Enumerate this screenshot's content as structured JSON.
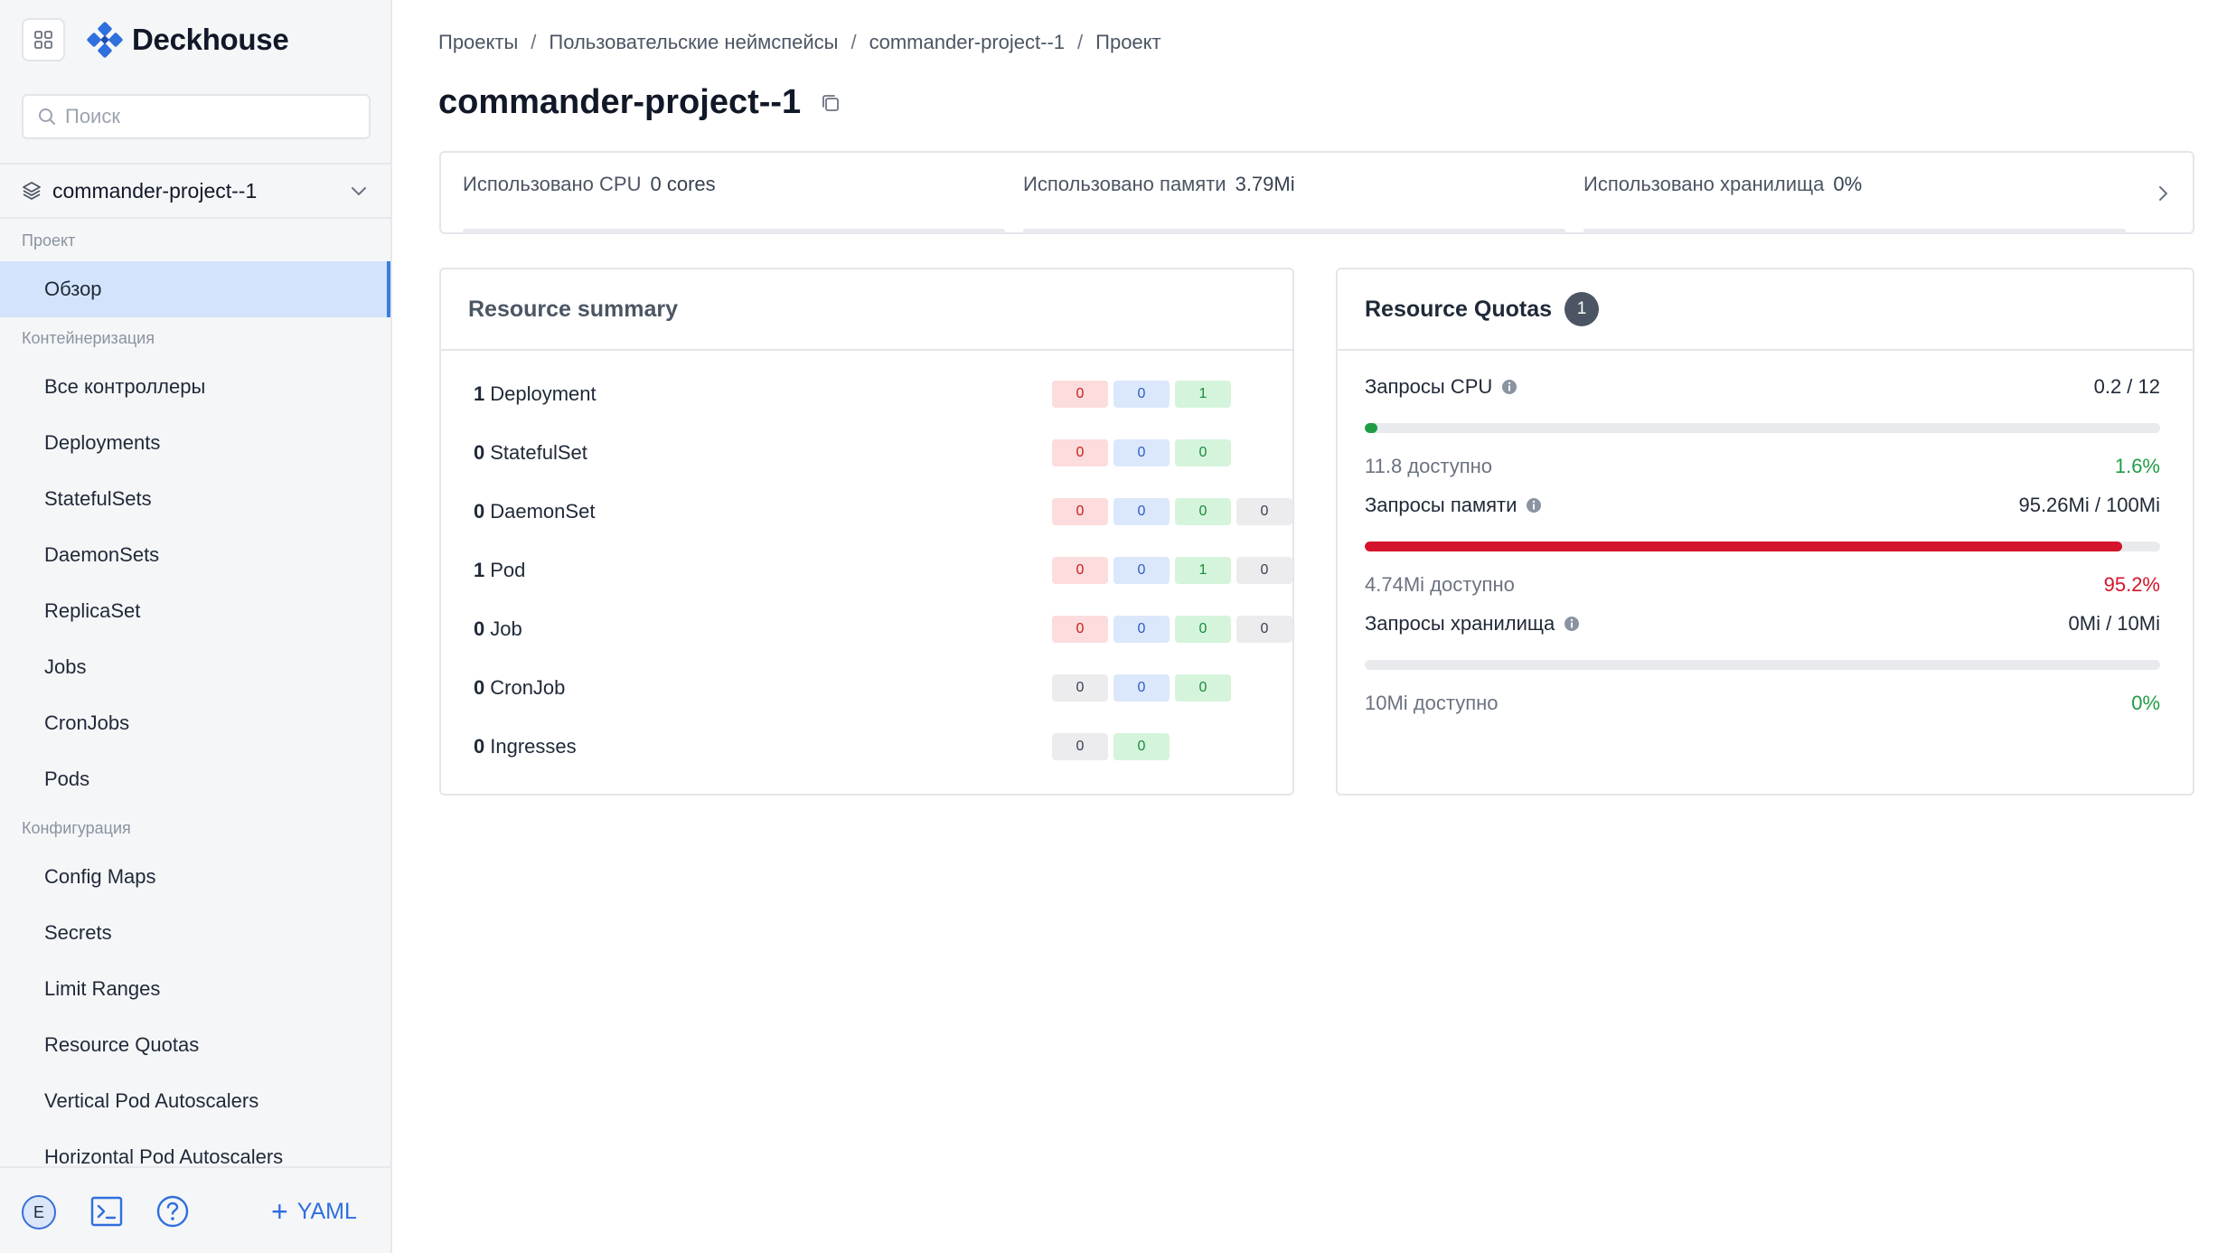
{
  "app": {
    "brand": "Deckhouse"
  },
  "search": {
    "placeholder": "Поиск"
  },
  "namespace": {
    "name": "commander-project--1"
  },
  "nav": {
    "groups": [
      {
        "label": "Проект",
        "items": [
          {
            "label": "Обзор",
            "active": true
          }
        ]
      },
      {
        "label": "Контейнеризация",
        "items": [
          {
            "label": "Все контроллеры"
          },
          {
            "label": "Deployments"
          },
          {
            "label": "StatefulSets"
          },
          {
            "label": "DaemonSets"
          },
          {
            "label": "ReplicaSet"
          },
          {
            "label": "Jobs"
          },
          {
            "label": "CronJobs"
          },
          {
            "label": "Pods"
          }
        ]
      },
      {
        "label": "Конфигурация",
        "items": [
          {
            "label": "Config Maps"
          },
          {
            "label": "Secrets"
          },
          {
            "label": "Limit Ranges"
          },
          {
            "label": "Resource Quotas"
          },
          {
            "label": "Vertical Pod Autoscalers"
          },
          {
            "label": "Horizontal Pod Autoscalers"
          }
        ]
      }
    ]
  },
  "footer": {
    "avatar": "E",
    "yaml_label": "YAML"
  },
  "breadcrumb": [
    "Проекты",
    "Пользовательские неймспейсы",
    "commander-project--1",
    "Проект"
  ],
  "page": {
    "title": "commander-project--1"
  },
  "usage": [
    {
      "label": "Использовано CPU",
      "value": "0 cores"
    },
    {
      "label": "Использовано памяти",
      "value": "3.79Mi"
    },
    {
      "label": "Использовано хранилища",
      "value": "0%"
    }
  ],
  "resource_summary": {
    "title": "Resource summary",
    "rows": [
      {
        "count": "1",
        "kind": "Deployment",
        "pills": [
          {
            "c": "red",
            "v": "0"
          },
          {
            "c": "blue",
            "v": "0"
          },
          {
            "c": "green",
            "v": "1"
          }
        ]
      },
      {
        "count": "0",
        "kind": "StatefulSet",
        "pills": [
          {
            "c": "red",
            "v": "0"
          },
          {
            "c": "blue",
            "v": "0"
          },
          {
            "c": "green",
            "v": "0"
          }
        ]
      },
      {
        "count": "0",
        "kind": "DaemonSet",
        "pills": [
          {
            "c": "red",
            "v": "0"
          },
          {
            "c": "blue",
            "v": "0"
          },
          {
            "c": "green",
            "v": "0"
          },
          {
            "c": "gray",
            "v": "0"
          }
        ]
      },
      {
        "count": "1",
        "kind": "Pod",
        "pills": [
          {
            "c": "red",
            "v": "0"
          },
          {
            "c": "blue",
            "v": "0"
          },
          {
            "c": "green",
            "v": "1"
          },
          {
            "c": "gray",
            "v": "0"
          }
        ]
      },
      {
        "count": "0",
        "kind": "Job",
        "pills": [
          {
            "c": "red",
            "v": "0"
          },
          {
            "c": "blue",
            "v": "0"
          },
          {
            "c": "green",
            "v": "0"
          },
          {
            "c": "gray",
            "v": "0"
          }
        ]
      },
      {
        "count": "0",
        "kind": "CronJob",
        "pills": [
          {
            "c": "gray",
            "v": "0"
          },
          {
            "c": "blue",
            "v": "0"
          },
          {
            "c": "green",
            "v": "0"
          }
        ]
      },
      {
        "count": "0",
        "kind": "Ingresses",
        "pills": [
          {
            "c": "gray",
            "v": "0"
          },
          {
            "c": "green",
            "v": "0"
          }
        ]
      }
    ]
  },
  "resource_quotas": {
    "title": "Resource Quotas",
    "count": "1",
    "items": [
      {
        "label": "Запросы CPU",
        "value": "0.2 / 12",
        "available": "11.8 доступно",
        "percent": "1.6%",
        "fill_fraction": 0.016,
        "color": "#1f9d45"
      },
      {
        "label": "Запросы памяти",
        "value": "95.26Mi / 100Mi",
        "available": "4.74Mi доступно",
        "percent": "95.2%",
        "fill_fraction": 0.952,
        "color": "#d4142b"
      },
      {
        "label": "Запросы хранилища",
        "value": "0Mi / 10Mi",
        "available": "10Mi доступно",
        "percent": "0%",
        "fill_fraction": 0,
        "color": "#1f9d45"
      }
    ]
  },
  "colors": {
    "accent": "#2f6fde",
    "active_bg": "#d3e3fb",
    "danger": "#d4142b",
    "success": "#1f9d45"
  }
}
